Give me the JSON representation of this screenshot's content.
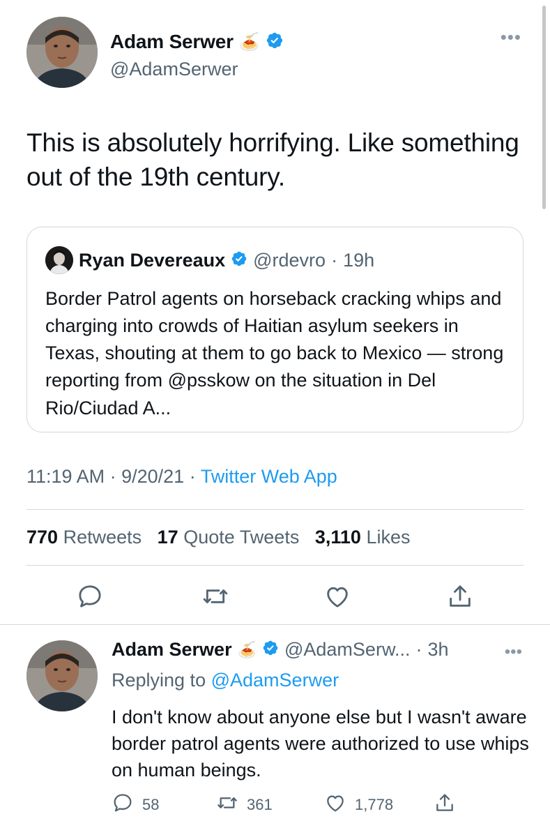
{
  "tweet": {
    "author": {
      "name": "Adam Serwer",
      "emoji": "🍝",
      "handle": "@AdamSerwer"
    },
    "more": "•••",
    "text": "This is absolutely horrifying. Like something out of the 19th century.",
    "quote": {
      "name": "Ryan Devereaux",
      "handle": "@rdevro",
      "sep": "·",
      "time": "19h",
      "text": "Border Patrol agents on horseback cracking whips and charging into crowds of Haitian asylum seekers in Texas, shouting at them to go back to Mexico — strong reporting from @psskow on the situation in Del Rio/Ciudad A..."
    },
    "meta": {
      "time": "11:19 AM",
      "sep1": "·",
      "date": "9/20/21",
      "sep2": "·",
      "app": "Twitter Web App"
    },
    "stats": {
      "retweets_count": "770",
      "retweets_label": "Retweets",
      "quotes_count": "17",
      "quotes_label": "Quote Tweets",
      "likes_count": "3,110",
      "likes_label": "Likes"
    }
  },
  "reply": {
    "name": "Adam Serwer",
    "emoji": "🍝",
    "handle": "@AdamSerw...",
    "sep": "·",
    "time": "3h",
    "more": "•••",
    "replying_prefix": "Replying to",
    "replying_to": "@AdamSerwer",
    "text": "I don't know about anyone else but I wasn't aware border patrol agents were authorized to use whips on human beings.",
    "replies": "58",
    "retweets": "361",
    "likes": "1,778"
  },
  "colors": {
    "accent": "#1d9bf0",
    "secondary_text": "#536471",
    "border": "#cfd9de",
    "verified": "#1d9bf0"
  }
}
